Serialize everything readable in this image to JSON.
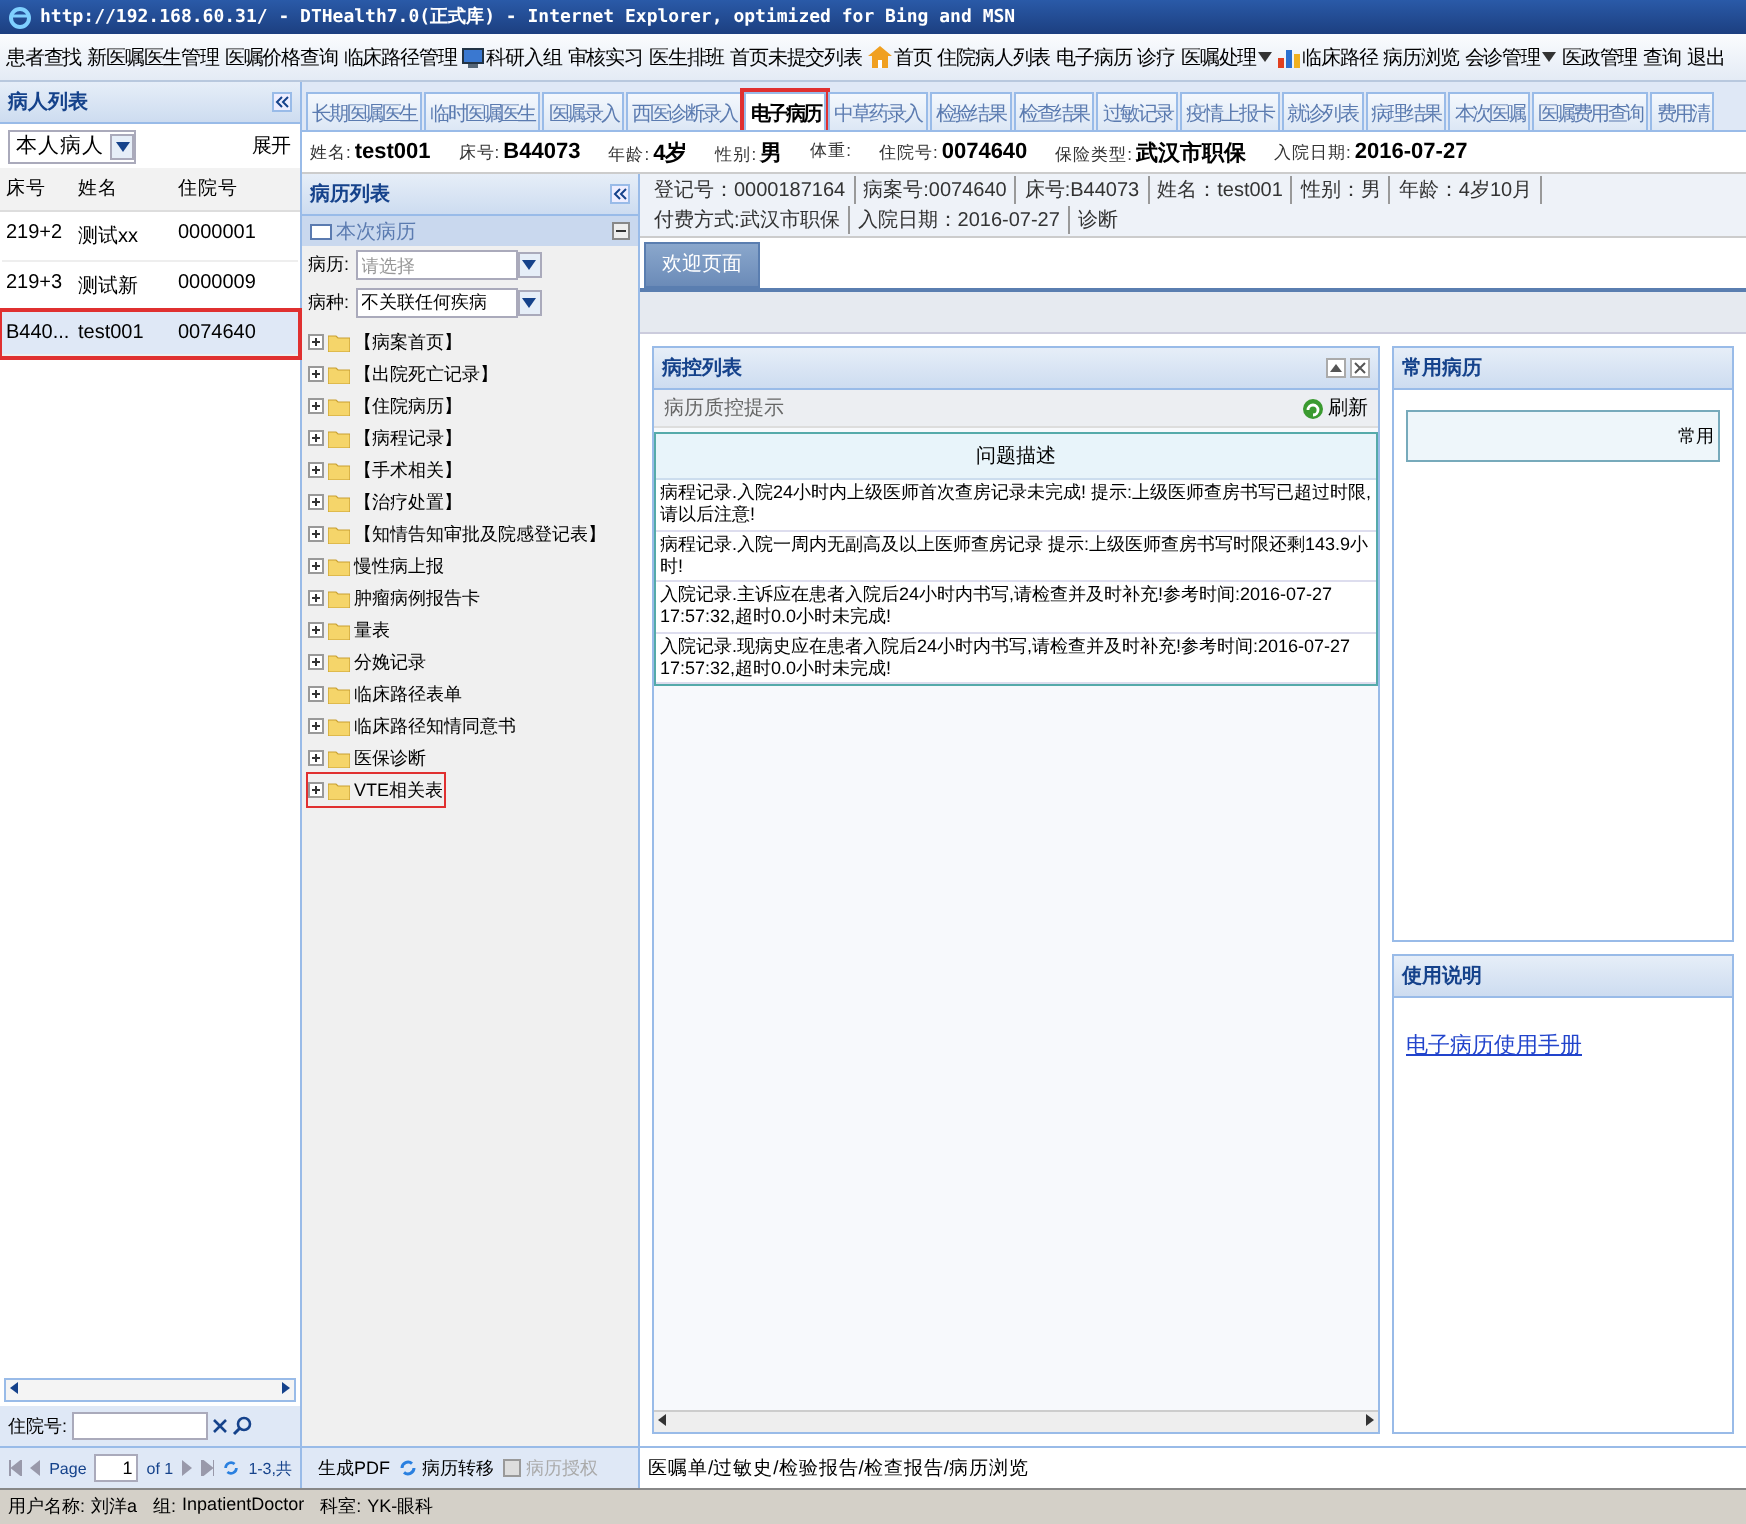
{
  "window": {
    "title": "http://192.168.60.31/ - DTHealth7.0(正式库) - Internet Explorer, optimized for Bing and MSN"
  },
  "menu": [
    {
      "label": "患者查找",
      "kind": "plain"
    },
    {
      "label": "新医嘱医生管理",
      "kind": "plain"
    },
    {
      "label": "医嘱价格查询",
      "kind": "plain"
    },
    {
      "label": "临床路径管理",
      "kind": "plain"
    },
    {
      "label": "科研入组",
      "kind": "monitor"
    },
    {
      "label": "审核实习",
      "kind": "plain"
    },
    {
      "label": "医生排班",
      "kind": "plain"
    },
    {
      "label": "首页未提交列表",
      "kind": "plain"
    },
    {
      "label": "首页",
      "kind": "home"
    },
    {
      "label": "住院病人列表",
      "kind": "plain"
    },
    {
      "label": "电子病历",
      "kind": "plain"
    },
    {
      "label": "诊疗",
      "kind": "plain"
    },
    {
      "label": "医嘱处理",
      "kind": "dropdown"
    },
    {
      "label": "临床路径",
      "kind": "chart"
    },
    {
      "label": "病历浏览",
      "kind": "plain"
    },
    {
      "label": "会诊管理",
      "kind": "dropdown"
    },
    {
      "label": "医政管理",
      "kind": "plain"
    },
    {
      "label": "查询",
      "kind": "plain"
    },
    {
      "label": "退出",
      "kind": "plain"
    }
  ],
  "patient_list": {
    "title": "病人列表",
    "filter": "本人病人",
    "expand": "展开",
    "columns": [
      "床号",
      "姓名",
      "住院号"
    ],
    "rows": [
      {
        "cells": [
          "219+2",
          "测试xx",
          "0000001"
        ],
        "selected": false,
        "highlighted": false
      },
      {
        "cells": [
          "219+3",
          "测试新",
          "0000009"
        ],
        "selected": false,
        "highlighted": false
      },
      {
        "cells": [
          "B440...",
          "test001",
          "0074640"
        ],
        "selected": true,
        "highlighted": true
      }
    ],
    "search_label": "住院号:",
    "pager": {
      "page_label": "Page",
      "page": "1",
      "of": "of 1",
      "summary": "1-3,共"
    }
  },
  "tabs": [
    {
      "label": "长期医嘱医生",
      "selected": false,
      "highlighted": false
    },
    {
      "label": "临时医嘱医生",
      "selected": false,
      "highlighted": false
    },
    {
      "label": "医嘱录入",
      "selected": false,
      "highlighted": false
    },
    {
      "label": "西医诊断录入",
      "selected": false,
      "highlighted": false
    },
    {
      "label": "电子病历",
      "selected": true,
      "highlighted": true
    },
    {
      "label": "中草药录入",
      "selected": false,
      "highlighted": false
    },
    {
      "label": "检验结果",
      "selected": false,
      "highlighted": false
    },
    {
      "label": "检查结果",
      "selected": false,
      "highlighted": false
    },
    {
      "label": "过敏记录",
      "selected": false,
      "highlighted": false
    },
    {
      "label": "疫情上报卡",
      "selected": false,
      "highlighted": false
    },
    {
      "label": "就诊列表",
      "selected": false,
      "highlighted": false
    },
    {
      "label": "病理结果",
      "selected": false,
      "highlighted": false
    },
    {
      "label": "本次医嘱",
      "selected": false,
      "highlighted": false
    },
    {
      "label": "医嘱费用查询",
      "selected": false,
      "highlighted": false
    },
    {
      "label": "费用清",
      "selected": false,
      "highlighted": false
    }
  ],
  "patient_header": [
    {
      "label": "姓名:",
      "value": "test001"
    },
    {
      "label": "床号:",
      "value": "B44073"
    },
    {
      "label": "年龄:",
      "value": "4岁"
    },
    {
      "label": "性别:",
      "value": "男"
    },
    {
      "label": "体重:"
    },
    {
      "label": "住院号:",
      "value": "0074640"
    },
    {
      "label": "保险类型:",
      "value": "武汉市职保"
    },
    {
      "label": "入院日期:",
      "value": "2016-07-27"
    }
  ],
  "record_list": {
    "title": "病历列表",
    "current": "本次病历",
    "fields": [
      {
        "label": "病历:",
        "placeholder": "请选择"
      },
      {
        "label": "病种:",
        "value": "不关联任何疾病"
      }
    ],
    "tree": [
      {
        "label": "【病案首页】",
        "expanded": false,
        "highlighted": false
      },
      {
        "label": "【出院死亡记录】",
        "expanded": false,
        "highlighted": false
      },
      {
        "label": "【住院病历】",
        "expanded": false,
        "highlighted": false
      },
      {
        "label": "【病程记录】",
        "expanded": false,
        "highlighted": false
      },
      {
        "label": "【手术相关】",
        "expanded": false,
        "highlighted": false
      },
      {
        "label": "【治疗处置】",
        "expanded": false,
        "highlighted": false
      },
      {
        "label": "【知情告知审批及院感登记表】",
        "expanded": false,
        "highlighted": false
      },
      {
        "label": "慢性病上报",
        "expanded": false,
        "highlighted": false
      },
      {
        "label": "肿瘤病例报告卡",
        "expanded": false,
        "highlighted": false
      },
      {
        "label": "量表",
        "expanded": false,
        "highlighted": false
      },
      {
        "label": "分娩记录",
        "expanded": false,
        "highlighted": false
      },
      {
        "label": "临床路径表单",
        "expanded": false,
        "highlighted": false
      },
      {
        "label": "临床路径知情同意书",
        "expanded": false,
        "highlighted": false
      },
      {
        "label": "医保诊断",
        "expanded": false,
        "highlighted": false
      },
      {
        "label": "VTE相关表",
        "expanded": false,
        "highlighted": true
      }
    ],
    "actions": [
      {
        "label": "生成PDF",
        "kind": "plain",
        "disabled": false
      },
      {
        "label": "病历转移",
        "kind": "transfer",
        "disabled": false
      },
      {
        "label": "病历授权",
        "kind": "authorize",
        "disabled": true
      }
    ]
  },
  "info_line": [
    "登记号：0000187164",
    "病案号:0074640",
    "床号:B44073",
    "姓名：test001",
    "性别：男",
    "年龄：4岁10月",
    "付费方式:武汉市职保",
    "入院日期：2016-07-27",
    "诊断"
  ],
  "page_tabs": [
    {
      "label": "欢迎页面",
      "selected": true
    }
  ],
  "qc_panel": {
    "title": "病控列表",
    "subtitle": "病历质控提示",
    "refresh": "刷新",
    "column": "问题描述",
    "rows": [
      "病程记录.入院24小时内上级医师首次查房记录未完成! 提示:上级医师查房书写已超过时限,请以后注意!",
      "病程记录.入院一周内无副高及以上医师查房记录 提示:上级医师查房书写时限还剩143.9小时!",
      "入院记录.主诉应在患者入院后24小时内书写,请检查并及时补充!参考时间:2016-07-27 17:57:32,超时0.0小时未完成!",
      "入院记录.现病史应在患者入院后24小时内书写,请检查并及时补充!参考时间:2016-07-27 17:57:32,超时0.0小时未完成!"
    ]
  },
  "common_panel": {
    "title": "常用病历",
    "header": "常用"
  },
  "usage_panel": {
    "title": "使用说明",
    "link": "电子病历使用手册"
  },
  "footer_links": "医嘱单/过敏史/检验报告/检查报告/病历浏览",
  "status_bar": [
    {
      "label": "用户名称:",
      "value": "刘洋a"
    },
    {
      "label": "组:",
      "value": "InpatientDoctor"
    },
    {
      "label": "科室:",
      "value": "YK-眼科"
    }
  ]
}
